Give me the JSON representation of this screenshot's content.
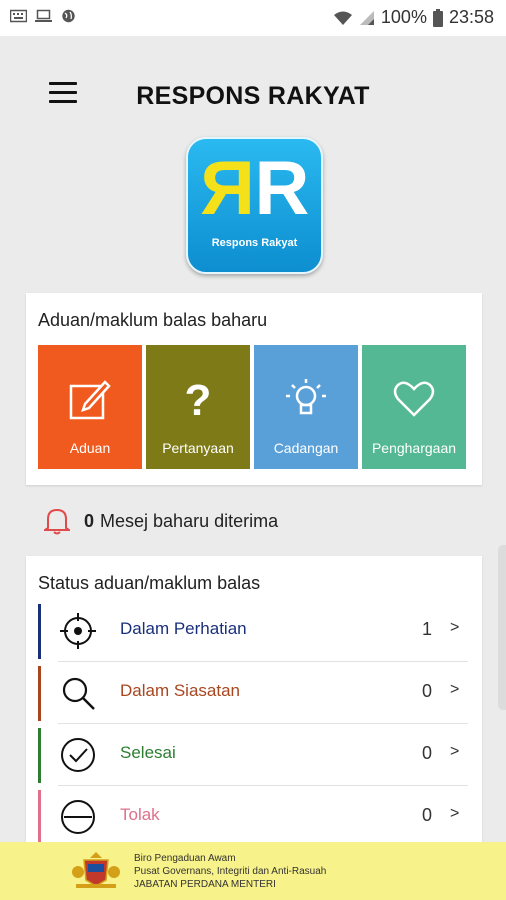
{
  "status_bar": {
    "battery": "100%",
    "time": "23:58"
  },
  "app": {
    "title": "RESPONS RAKYAT",
    "logo_letters_left": "R",
    "logo_letters_right": "R",
    "logo_text": "Respons Rakyat"
  },
  "new_feedback": {
    "heading": "Aduan/maklum balas baharu",
    "tiles": [
      {
        "label": "Aduan",
        "color": "#f15a1e",
        "icon": "edit-icon"
      },
      {
        "label": "Pertanyaan",
        "color": "#7e7a17",
        "icon": "question-icon"
      },
      {
        "label": "Cadangan",
        "color": "#5aa0d8",
        "icon": "lightbulb-icon"
      },
      {
        "label": "Penghargaan",
        "color": "#55b894",
        "icon": "heart-icon"
      }
    ]
  },
  "notification": {
    "count": "0",
    "text": "Mesej baharu diterima"
  },
  "status": {
    "heading": "Status aduan/maklum balas",
    "rows": [
      {
        "label": "Dalam Perhatian",
        "count": "1",
        "arrow": ">",
        "color": "#1a2f7a",
        "icon": "target-icon"
      },
      {
        "label": "Dalam Siasatan",
        "count": "0",
        "arrow": ">",
        "color": "#a8461f",
        "icon": "magnifier-icon"
      },
      {
        "label": "Selesai",
        "count": "0",
        "arrow": ">",
        "color": "#2e7d32",
        "icon": "check-circle-icon"
      },
      {
        "label": "Tolak",
        "count": "0",
        "arrow": ">",
        "color": "#e0708a",
        "icon": "minus-circle-icon"
      }
    ]
  },
  "footer": {
    "line1": "Biro Pengaduan Awam",
    "line2": "Pusat Governans, Integriti dan Anti-Rasuah",
    "line3": "JABATAN PERDANA MENTERI"
  }
}
